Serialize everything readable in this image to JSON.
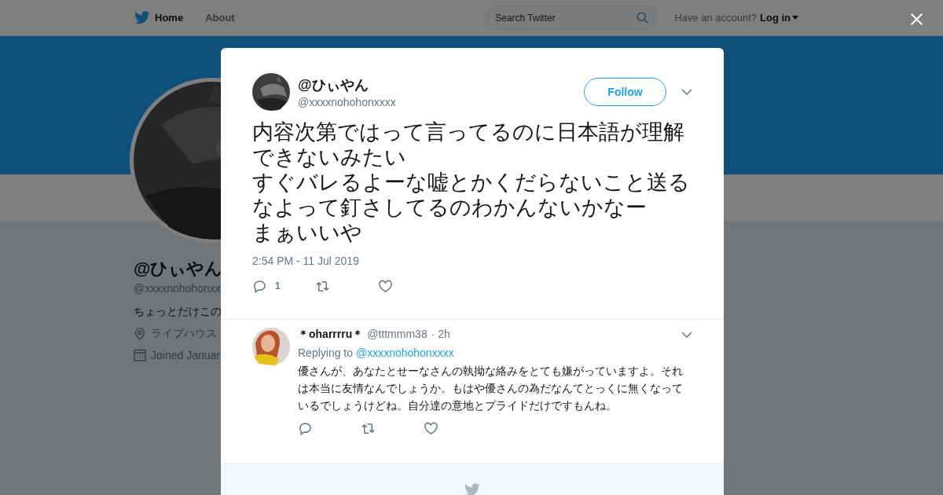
{
  "nav": {
    "items": [
      {
        "label": "Home",
        "selected": true
      },
      {
        "label": "About",
        "selected": false
      }
    ],
    "search": {
      "placeholder": "Search Twitter"
    },
    "account_prompt": "Have an account?",
    "login": "Log in"
  },
  "profile": {
    "name": "@ひぃやん",
    "handle": "@xxxxnohohonxx",
    "bio": "ちょっとだけこの",
    "location": "ライブハウス",
    "joined": "Joined Januar"
  },
  "tweet": {
    "name": "@ひぃやん",
    "handle": "@xxxxnohohonxxxx",
    "follow": "Follow",
    "text_lines": [
      "内容次第ではって言ってるのに日本語が理解できないみたい",
      "すぐバレるよーな嘘とかくだらないこと送るなよって釘さしてるのわかんないかなー",
      "まぁいいや"
    ],
    "time": "2:54 PM - 11 Jul 2019",
    "reply_count": "1"
  },
  "replies": [
    {
      "name": "＊oharrrru＊",
      "handle": "@tttmmm38",
      "age": "· 2h",
      "replying_label": "Replying to",
      "replying_to": "@xxxxnohohonxxxx",
      "text": "優さんが、あなたとせーなさんの執拗な絡みをとても嫌がっていますよ。それは本当に友情なんでしょうか。もはや優さんの為だなんてとっくに無くなっているでしょうけどね。自分達の意地とプライドだけですもんね。"
    }
  ]
}
